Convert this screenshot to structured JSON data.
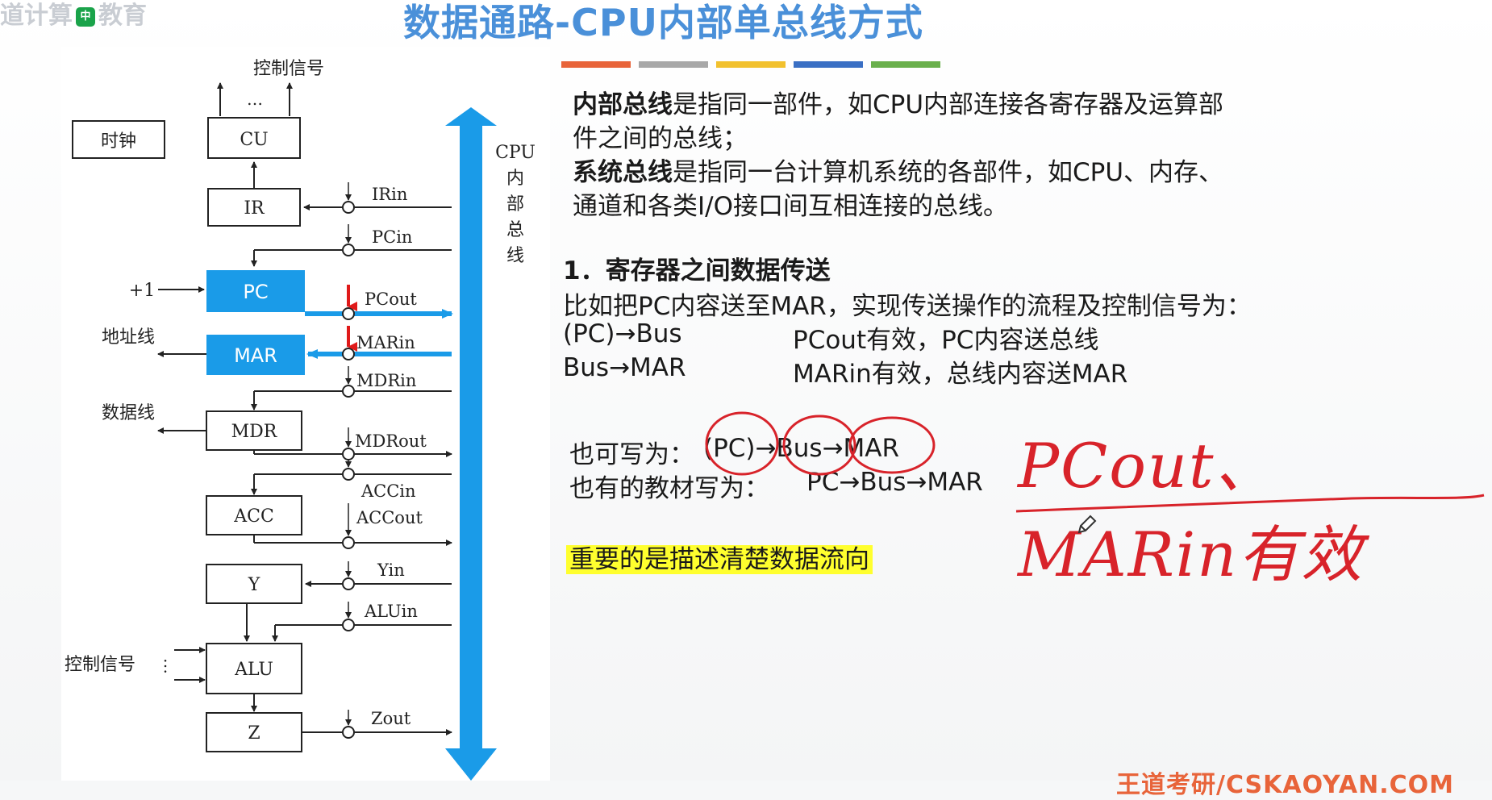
{
  "slide": {
    "title": "数据通路-CPU内部单总线方式",
    "logo_text_left": "道计算",
    "logo_badge": "中",
    "logo_text_right": "教育",
    "logo_sub": "",
    "footer": "王道考研/CSKAOYAN.COM"
  },
  "colors": {
    "accent_blue": "#1a9be8",
    "title_blue": "#4a90d9",
    "bar_colors": [
      "#e8643a",
      "#a8a8a8",
      "#f2c12e",
      "#3a6fc4",
      "#6ab04c"
    ],
    "highlight": "#ffff2e",
    "annotation_red": "#d8232a"
  },
  "diagram": {
    "bus_label": [
      "CPU",
      "内",
      "部",
      "总",
      "线"
    ],
    "control_top": "控制信号",
    "control_dots": "…",
    "clock": "时钟",
    "plus_one": "+1",
    "address_line": "地址线",
    "data_line": "数据线",
    "control_bottom": "控制信号",
    "registers": {
      "cu": "CU",
      "ir": "IR",
      "pc": "PC",
      "mar": "MAR",
      "mdr": "MDR",
      "acc": "ACC",
      "y": "Y",
      "alu": "ALU",
      "z": "Z"
    },
    "signals": {
      "irin": "IRin",
      "pcin": "PCin",
      "pcout": "PCout",
      "marin": "MARin",
      "mdrin": "MDRin",
      "mdrout": "MDRout",
      "accin": "ACCin",
      "accout": "ACCout",
      "yin": "Yin",
      "aluin": "ALUin",
      "zout": "Zout"
    }
  },
  "text": {
    "p1_term": "内部总线",
    "p1_rest_line1": "是指同一部件，如CPU内部连接各寄存器及运算部",
    "p1_line2": "件之间的总线；",
    "p2_term": "系统总线",
    "p2_rest_line1": "是指同一台计算机系统的各部件，如CPU、内存、",
    "p2_line2": "通道和各类I/O接口间互相连接的总线。",
    "section1": "1．寄存器之间数据传送",
    "example_intro": "比如把PC内容送至MAR，实现传送操作的流程及控制信号为：",
    "step1_left": "(PC)→Bus",
    "step1_right": "PCout有效，PC内容送总线",
    "step2_left": "Bus→MAR",
    "step2_right": "MARin有效，总线内容送MAR",
    "alt1_label": "也可写为：",
    "alt1_value": "(PC)→Bus→MAR",
    "alt2_label": "也有的教材写为：",
    "alt2_value": "PC→Bus→MAR",
    "key_point": "重要的是描述清楚数据流向"
  },
  "handwriting": {
    "note": "PCout、MARin有效"
  }
}
